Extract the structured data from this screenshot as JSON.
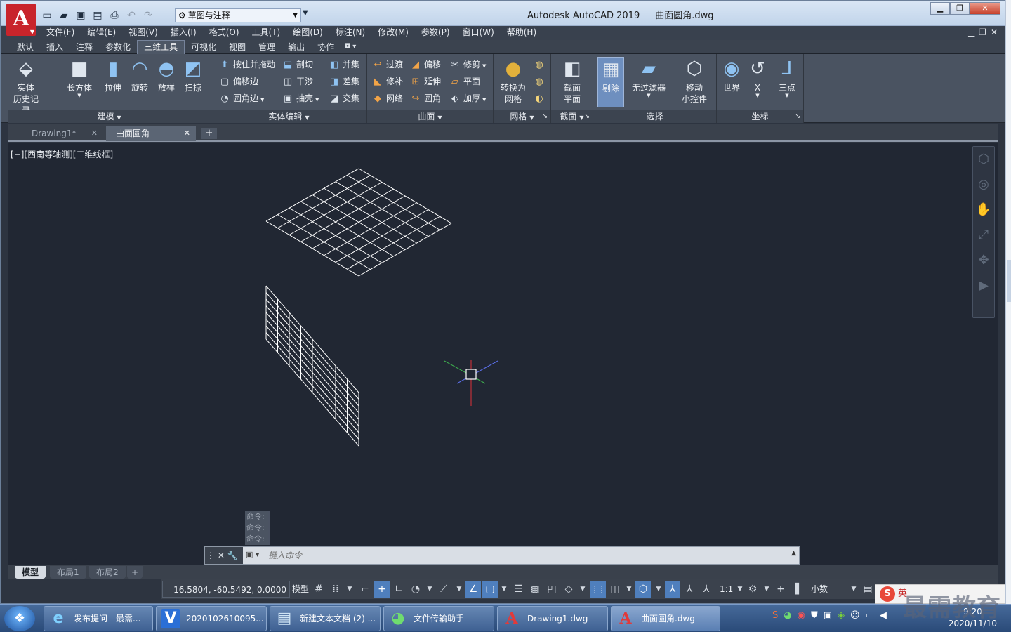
{
  "app": {
    "logo_letter": "A",
    "title": "Autodesk AutoCAD 2019",
    "file": "曲面圆角.dwg",
    "workspace": "草图与注释"
  },
  "menus": [
    "文件(F)",
    "编辑(E)",
    "视图(V)",
    "插入(I)",
    "格式(O)",
    "工具(T)",
    "绘图(D)",
    "标注(N)",
    "修改(M)",
    "参数(P)",
    "窗口(W)",
    "帮助(H)"
  ],
  "ribbon_tabs": [
    "默认",
    "插入",
    "注释",
    "参数化",
    "三维工具",
    "可视化",
    "视图",
    "管理",
    "输出",
    "协作"
  ],
  "ribbon_active_tab": "三维工具",
  "panels": {
    "modeling": {
      "title": "建模",
      "buttons": [
        "实体\n历史记录",
        "长方体",
        "拉伸",
        "旋转",
        "放样",
        "扫掠"
      ]
    },
    "solid_edit": {
      "title": "实体编辑",
      "buttons": [
        "按住并拖动",
        "剖切",
        "并集",
        "偏移边",
        "干涉",
        "差集",
        "圆角边",
        "抽壳",
        "交集"
      ]
    },
    "surface": {
      "title": "曲面",
      "buttons": [
        "过渡",
        "偏移",
        "修剪",
        "修补",
        "延伸",
        "平面",
        "网络",
        "圆角",
        "加厚"
      ]
    },
    "mesh": {
      "title": "网格",
      "buttons": [
        "转换为\n网格"
      ]
    },
    "section": {
      "title": "截面",
      "buttons": [
        "截面\n平面"
      ]
    },
    "selection": {
      "title": "选择",
      "buttons": [
        "剔除",
        "无过滤器",
        "移动\n小控件"
      ]
    },
    "coordinates": {
      "title": "坐标",
      "buttons": [
        "世界",
        "X",
        "三点"
      ]
    }
  },
  "doc_tabs": [
    "Drawing1*",
    "曲面圆角"
  ],
  "doc_tab_active": 1,
  "viewport": {
    "label": "[−][西南等轴测][二维线框]"
  },
  "command": {
    "history": [
      "命令:",
      "命令:",
      "命令:"
    ],
    "placeholder": "键入命令"
  },
  "layout_tabs": [
    "模型",
    "布局1",
    "布局2"
  ],
  "status": {
    "coords": "16.5804, -60.5492, 0.0000",
    "model": "模型",
    "scale": "1:1",
    "units": "小数"
  },
  "taskbar": {
    "items": [
      "发布提问 - 最需...",
      "2020102610095...",
      "新建文本文档 (2) ...",
      "文件传输助手",
      "Drawing1.dwg",
      "曲面圆角.dwg"
    ],
    "clock_time": "9:20",
    "clock_date": "2020/11/10"
  },
  "ime": "英",
  "watermark": "最需教育",
  "colors": {
    "viewport_bg": "#212733",
    "wire": "#ffffff",
    "ribbon": "#4a5361",
    "accent": "#4f7fbd",
    "axis_red": "#e0303a",
    "axis_green": "#3fb34f",
    "axis_blue": "#5b6ee8"
  }
}
